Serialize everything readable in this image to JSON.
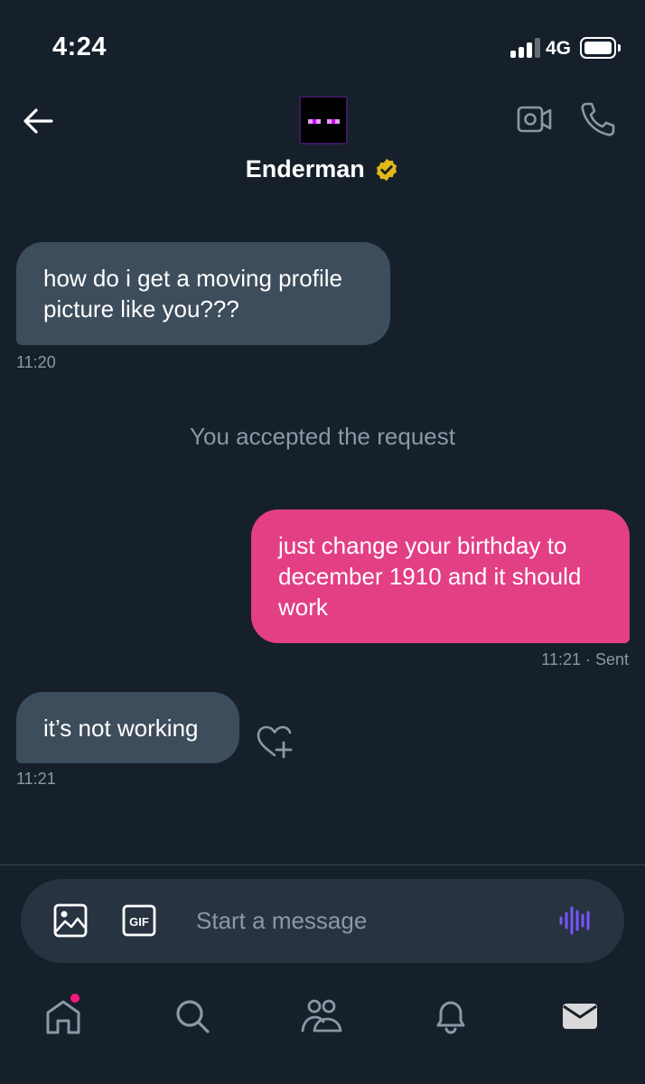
{
  "status_bar": {
    "time": "4:24",
    "network": "4G"
  },
  "header": {
    "display_name": "Enderman",
    "verified": true,
    "icons": [
      "back-arrow-icon",
      "video-call-icon",
      "phone-icon",
      "verified-badge-icon"
    ]
  },
  "messages": [
    {
      "direction": "received",
      "text": "how do i get a moving profile picture like you???",
      "time": "11:20"
    },
    {
      "direction": "system",
      "text": "You accepted the request"
    },
    {
      "direction": "sent",
      "text": "just change your birthday to december 1910 and it should work",
      "time": "11:21 · Sent"
    },
    {
      "direction": "received",
      "text": "it’s not working",
      "time": "11:21"
    }
  ],
  "composer": {
    "placeholder": "Start a message",
    "gif_label": "GIF"
  },
  "tabbar": {
    "items": [
      "home",
      "search",
      "communities",
      "notifications",
      "messages"
    ],
    "home_has_notification": true
  },
  "colors": {
    "background": "#15202b",
    "received_bubble": "#3e4d5c",
    "sent_bubble": "#e33f84",
    "muted_text": "#8b98a5",
    "verified_gold": "#e2b719",
    "voice_accent": "#7856ff",
    "notification_dot": "#f91880"
  }
}
